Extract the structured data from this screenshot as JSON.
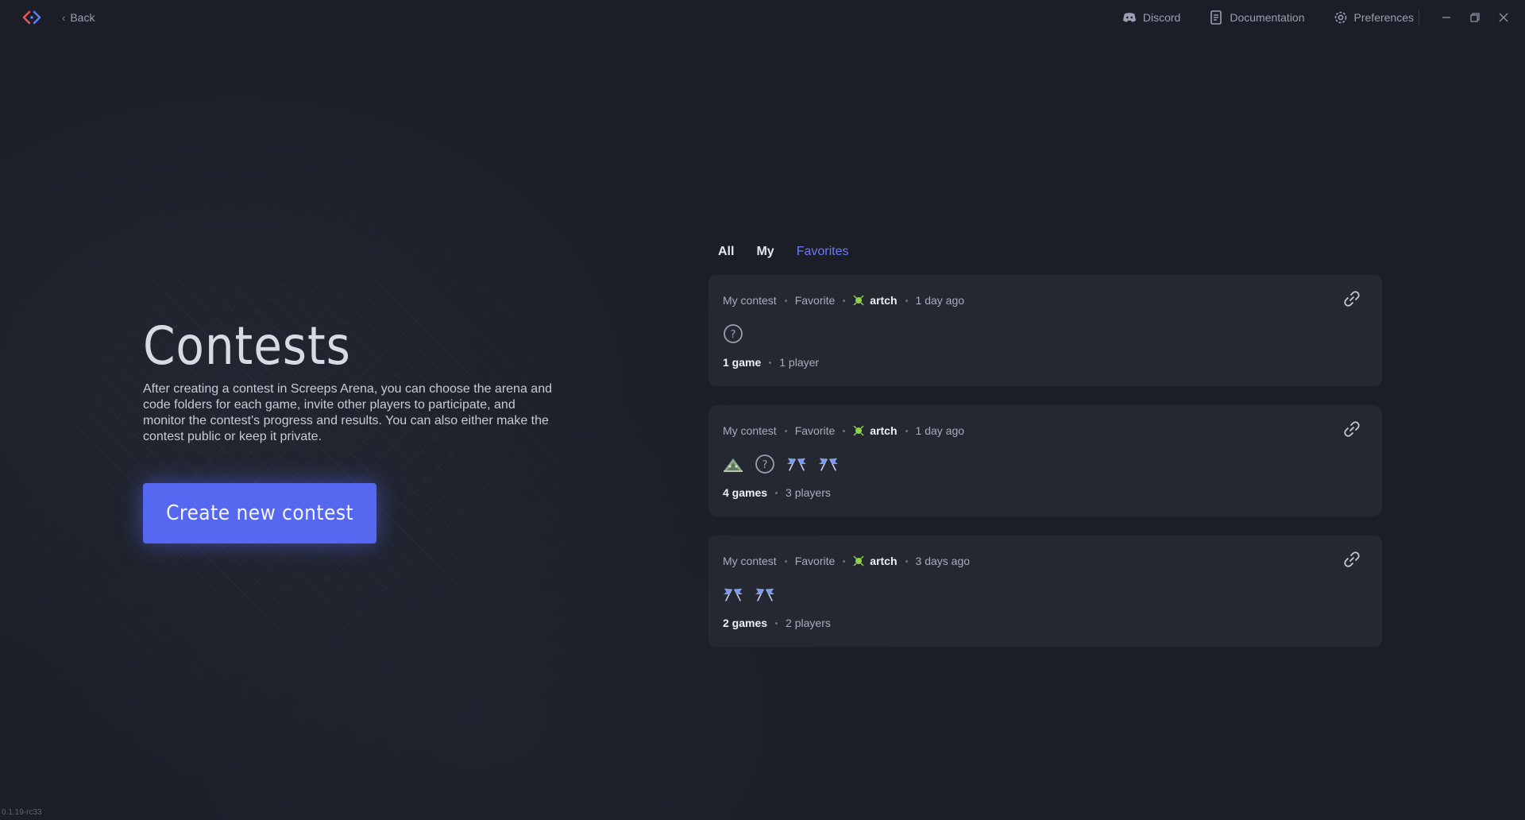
{
  "titlebar": {
    "back_label": "Back",
    "links": [
      {
        "label": "Discord",
        "icon": "discord-icon"
      },
      {
        "label": "Documentation",
        "icon": "document-icon"
      },
      {
        "label": "Preferences",
        "icon": "gear-icon"
      }
    ]
  },
  "hero": {
    "title": "Contests",
    "description": "After creating a contest in Screeps Arena, you can choose the arena and code folders for each game, invite other players to participate, and monitor the contest's progress and results. You can also either make the contest public or keep it private.",
    "create_label": "Create new contest"
  },
  "tabs": [
    {
      "label": "All"
    },
    {
      "label": "My"
    },
    {
      "label": "Favorites"
    }
  ],
  "contests": [
    {
      "type": "My contest",
      "favorite": "Favorite",
      "author": "artch",
      "age": "1 day ago",
      "games_label": "1 game",
      "players_label": "1 player",
      "game_icons": [
        "question-icon"
      ]
    },
    {
      "type": "My contest",
      "favorite": "Favorite",
      "author": "artch",
      "age": "1 day ago",
      "games_label": "4 games",
      "players_label": "3 players",
      "game_icons": [
        "tent-icon",
        "question-icon",
        "flags-icon",
        "flags-icon"
      ]
    },
    {
      "type": "My contest",
      "favorite": "Favorite",
      "author": "artch",
      "age": "3 days ago",
      "games_label": "2 games",
      "players_label": "2 players",
      "game_icons": [
        "flags-icon",
        "flags-icon"
      ]
    }
  ],
  "version": "0.1.19-rc33",
  "colors": {
    "accent": "#5668ef",
    "active_tab": "#6b7bf2",
    "card_bg": "#262831",
    "avatar": "#8fd14f"
  }
}
